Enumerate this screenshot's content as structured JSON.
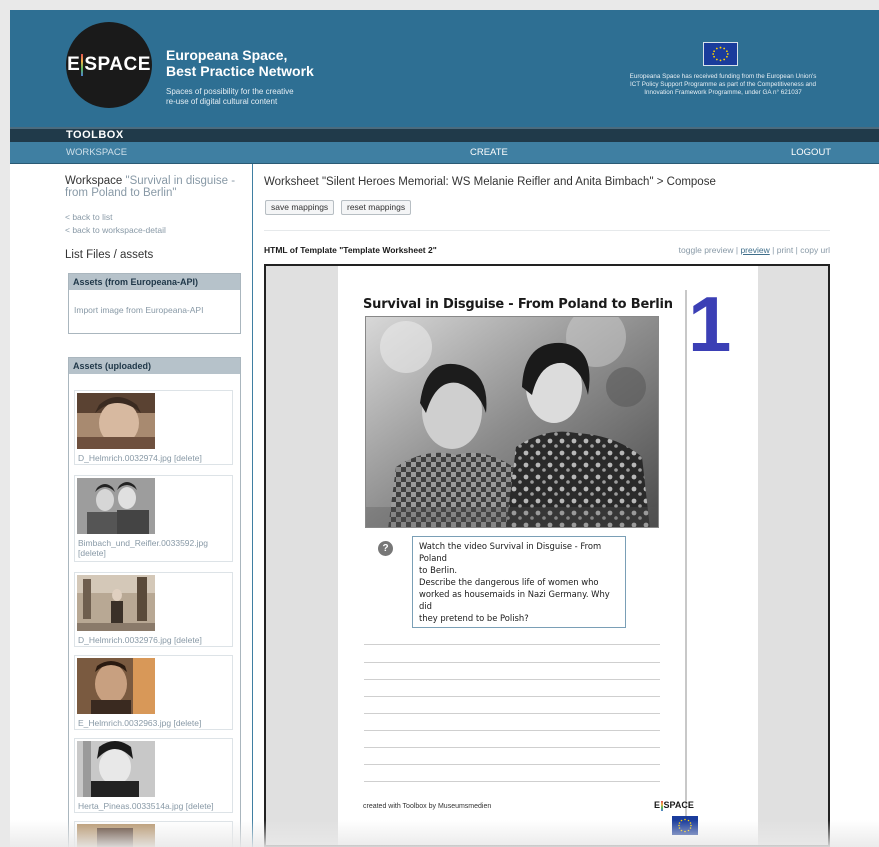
{
  "header": {
    "logo_text_left": "E",
    "logo_text_right": "SPACE",
    "brand_line1": "Europeana Space,",
    "brand_line2": "Best Practice Network",
    "tagline_line1": "Spaces of possibility for the creative",
    "tagline_line2": "re-use of digital cultural content",
    "eu_funding_line1": "Europeana Space has received funding from the European Union's",
    "eu_funding_line2": "ICT Policy Support Programme as part of the Competitiveness and",
    "eu_funding_line3": "Innovation Framework Programme, under GA n° 621037"
  },
  "toolbox_label": "TOOLBOX",
  "nav": {
    "workspace": "WORKSPACE",
    "create": "CREATE",
    "logout": "LOGOUT"
  },
  "sidebar": {
    "workspace_label": "Workspace",
    "workspace_name": "\"Survival in disguise - from Poland to Berlin\"",
    "back_to_list": "< back to list",
    "back_to_detail": "< back to workspace-detail",
    "list_files": "List Files / assets",
    "assets_api_title": "Assets (from Europeana-API)",
    "import_link": "Import image from Europeana-API",
    "assets_uploaded_title": "Assets (uploaded)",
    "assets": [
      {
        "filename": "D_Helmrich.0032974.jpg",
        "delete": "[delete]"
      },
      {
        "filename": "Bimbach_und_Reifler.0033592.jpg",
        "delete": "[delete]"
      },
      {
        "filename": "D_Helmrich.0032976.jpg",
        "delete": "[delete]"
      },
      {
        "filename": "E_Helmrich.0032963.jpg",
        "delete": "[delete]"
      },
      {
        "filename": "Herta_Pineas.0033514a.jpg",
        "delete": "[delete]"
      }
    ]
  },
  "main": {
    "title": "Worksheet \"Silent Heroes Memorial: WS Melanie Reifler and Anita Bimbach\" > Compose",
    "save_mappings": "save mappings",
    "reset_mappings": "reset mappings",
    "template_label": "HTML of Template \"Template Worksheet 2\"",
    "toggle_preview": "toggle preview",
    "preview": "preview",
    "print": "print",
    "copy_url": "copy url",
    "sep": "|"
  },
  "worksheet": {
    "title": "Survival in Disguise - From Poland to Berlin",
    "number": "1",
    "question_icon": "?",
    "task_line1": "Watch the video Survival in Disguise - From Poland",
    "task_line2": "to Berlin.",
    "task_line3": "Describe the dangerous life of women who",
    "task_line4": "worked as housemaids in Nazi Germany. Why did",
    "task_line5": "they pretend to be Polish?",
    "footer": "created with Toolbox by Museumsmedien",
    "footer_logo_left": "E",
    "footer_logo_right": "SPACE"
  },
  "colors": {
    "banner": "#2e6f93",
    "nav": "#3f7fa2",
    "toolbox": "#203a4a",
    "number": "#3b3fb5"
  }
}
